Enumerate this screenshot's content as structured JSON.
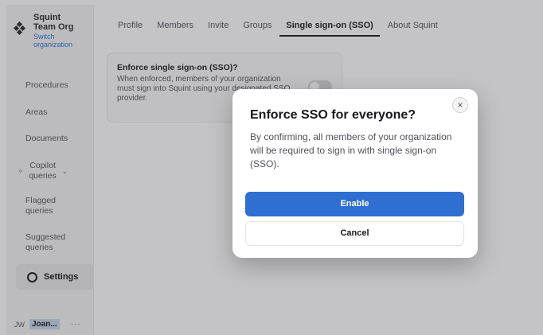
{
  "sidebar": {
    "org": {
      "name": "Squint Team Org",
      "switch_label": "Switch organization"
    },
    "items": [
      {
        "label": "Procedures"
      },
      {
        "label": "Areas"
      },
      {
        "label": "Documents"
      },
      {
        "label": "Copilot queries"
      },
      {
        "label": "Flagged queries"
      },
      {
        "label": "Suggested queries"
      },
      {
        "label": "Settings"
      }
    ],
    "user": {
      "initials": "JW",
      "name": "Joan...",
      "more": "···"
    }
  },
  "tabs": [
    {
      "label": "Profile"
    },
    {
      "label": "Members"
    },
    {
      "label": "Invite"
    },
    {
      "label": "Groups"
    },
    {
      "label": "Single sign-on (SSO)",
      "active": true
    },
    {
      "label": "About Squint"
    }
  ],
  "sso_card": {
    "title": "Enforce single sign-on (SSO)?",
    "description": "When enforced, members of your organization must sign into Squint using your designated SSO provider.",
    "enforced": false
  },
  "modal": {
    "title": "Enforce SSO for everyone?",
    "close_icon": "×",
    "message": "By confirming, all members of your organization will be required to sign in with single sign-on (SSO).",
    "confirm_label": "Enable",
    "cancel_label": "Cancel"
  },
  "colors": {
    "accent": "#2e6fd1"
  }
}
